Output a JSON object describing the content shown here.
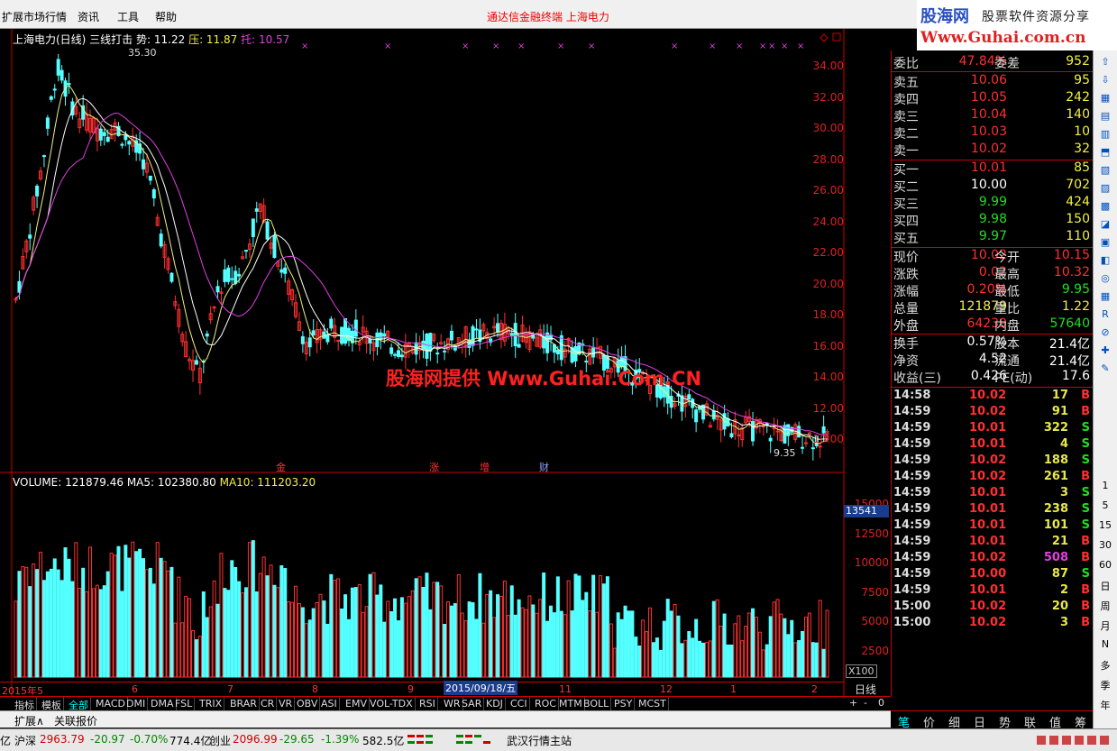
{
  "menu": {
    "items": [
      "扩展市场行情",
      "资讯",
      "工具",
      "帮助"
    ],
    "center_title": "通达信金融终端   上海电力"
  },
  "logo": {
    "line1": "股海网",
    "line1b": "股票软件资源分享",
    "line2": "Www.Guhai.com.cn"
  },
  "kline": {
    "info_title": "上海电力(日线) 三线打击",
    "info_shi": "势: 11.22",
    "info_ya": "压: 11.87",
    "info_tuo": "托: 10.57",
    "high_label": "35.30",
    "low_label": "9.35",
    "y_ticks": [
      "34.00",
      "32.00",
      "30.00",
      "28.00",
      "26.00",
      "24.00",
      "22.00",
      "20.00",
      "18.00",
      "16.00",
      "14.00",
      "12.00",
      "10.00"
    ],
    "events": [
      "金",
      "涨",
      "增",
      "财"
    ]
  },
  "watermark": "股海网提供 Www.Guhai.Com.CN",
  "volume": {
    "info_vol": "VOLUME: 121879.46",
    "info_ma5": "MA5: 102380.80",
    "info_ma10": "MA10: 111203.20",
    "y_ticks": [
      "15000",
      "12500",
      "10000",
      "7500",
      "5000",
      "2500"
    ],
    "cursor_value": "13541",
    "scale": "X100"
  },
  "date_axis": {
    "labels": [
      "2015年5",
      "6",
      "7",
      "8",
      "9",
      "11",
      "12",
      "1",
      "2"
    ],
    "selected": "2015/09/18/五",
    "period": "日线"
  },
  "indicator_tabs": [
    "指标",
    "模板",
    "全部",
    "MACD",
    "DMI",
    "DMA",
    "FSL",
    "TRIX",
    "BRAR",
    "CR",
    "VR",
    "OBV",
    "ASI",
    "EMV",
    "VOL-TDX",
    "RSI",
    "WR",
    "SAR",
    "KDJ",
    "CCI",
    "ROC",
    "MTM",
    "BOLL",
    "PSY",
    "MCST"
  ],
  "small_controls": [
    "+",
    "-",
    "0"
  ],
  "bottom_links": [
    "扩展∧",
    "关联报价"
  ],
  "quote": {
    "weibi": {
      "label": "委比",
      "value": "47.84%",
      "label2": "委差",
      "value2": "952"
    },
    "sell": [
      {
        "label": "卖五",
        "price": "10.06",
        "vol": "95"
      },
      {
        "label": "卖四",
        "price": "10.05",
        "vol": "242"
      },
      {
        "label": "卖三",
        "price": "10.04",
        "vol": "140"
      },
      {
        "label": "卖二",
        "price": "10.03",
        "vol": "10"
      },
      {
        "label": "卖一",
        "price": "10.02",
        "vol": "32"
      }
    ],
    "buy": [
      {
        "label": "买一",
        "price": "10.01",
        "vol": "85"
      },
      {
        "label": "买二",
        "price": "10.00",
        "vol": "702"
      },
      {
        "label": "买三",
        "price": "9.99",
        "vol": "424"
      },
      {
        "label": "买四",
        "price": "9.98",
        "vol": "150"
      },
      {
        "label": "买五",
        "price": "9.97",
        "vol": "110"
      }
    ],
    "stats": [
      {
        "l1": "现价",
        "v1": "10.02",
        "l2": "今开",
        "v2": "10.15"
      },
      {
        "l1": "涨跌",
        "v1": "0.02",
        "l2": "最高",
        "v2": "10.32"
      },
      {
        "l1": "涨幅",
        "v1": "0.20%",
        "l2": "最低",
        "v2": "9.95"
      },
      {
        "l1": "总量",
        "v1": "121879",
        "l2": "量比",
        "v2": "1.22"
      },
      {
        "l1": "外盘",
        "v1": "64239",
        "l2": "内盘",
        "v2": "57640"
      }
    ],
    "fund": [
      {
        "l1": "换手",
        "v1": "0.57%",
        "l2": "股本",
        "v2": "21.4亿"
      },
      {
        "l1": "净资",
        "v1": "4.52",
        "l2": "流通",
        "v2": "21.4亿"
      },
      {
        "l1": "收益(三)",
        "v1": "0.426",
        "l2": "PE(动)",
        "v2": "17.6"
      }
    ],
    "ticks": [
      {
        "t": "14:58",
        "p": "10.02",
        "v": "17",
        "d": "B"
      },
      {
        "t": "14:59",
        "p": "10.02",
        "v": "91",
        "d": "B"
      },
      {
        "t": "14:59",
        "p": "10.01",
        "v": "322",
        "d": "S"
      },
      {
        "t": "14:59",
        "p": "10.01",
        "v": "4",
        "d": "S"
      },
      {
        "t": "14:59",
        "p": "10.02",
        "v": "188",
        "d": "S"
      },
      {
        "t": "14:59",
        "p": "10.02",
        "v": "261",
        "d": "B"
      },
      {
        "t": "14:59",
        "p": "10.01",
        "v": "3",
        "d": "S"
      },
      {
        "t": "14:59",
        "p": "10.01",
        "v": "238",
        "d": "S"
      },
      {
        "t": "14:59",
        "p": "10.01",
        "v": "101",
        "d": "S"
      },
      {
        "t": "14:59",
        "p": "10.01",
        "v": "21",
        "d": "B"
      },
      {
        "t": "14:59",
        "p": "10.02",
        "v": "508",
        "d": "B"
      },
      {
        "t": "14:59",
        "p": "10.00",
        "v": "87",
        "d": "S"
      },
      {
        "t": "14:59",
        "p": "10.01",
        "v": "2",
        "d": "B"
      },
      {
        "t": "15:00",
        "p": "10.02",
        "v": "20",
        "d": "B"
      },
      {
        "t": "15:00",
        "p": "10.02",
        "v": "3",
        "d": "B"
      }
    ]
  },
  "bottom_tabs": [
    "笔",
    "价",
    "细",
    "日",
    "势",
    "联",
    "值",
    "筹"
  ],
  "right_toolbar": [
    "1",
    "5",
    "15",
    "30",
    "60",
    "日",
    "周",
    "月",
    "N",
    "多",
    "季",
    "年"
  ],
  "status": {
    "index1_name": "沪深",
    "index1_val": "2963.79",
    "index1_chg": "-20.97",
    "index1_pct": "-0.70%",
    "index1_amt": "774.4亿",
    "index2_name": "创业",
    "index2_val": "2096.99",
    "index2_chg": "-29.65",
    "index2_pct": "-1.39%",
    "index2_amt": "582.5亿",
    "prefix": "亿",
    "server": "武汉行情主站"
  },
  "colors": {
    "up": "#ff3030",
    "down": "#54ffff",
    "ma_yellow": "#f0f080",
    "ma_magenta": "#e040e0",
    "ma_white": "#ffffff"
  }
}
